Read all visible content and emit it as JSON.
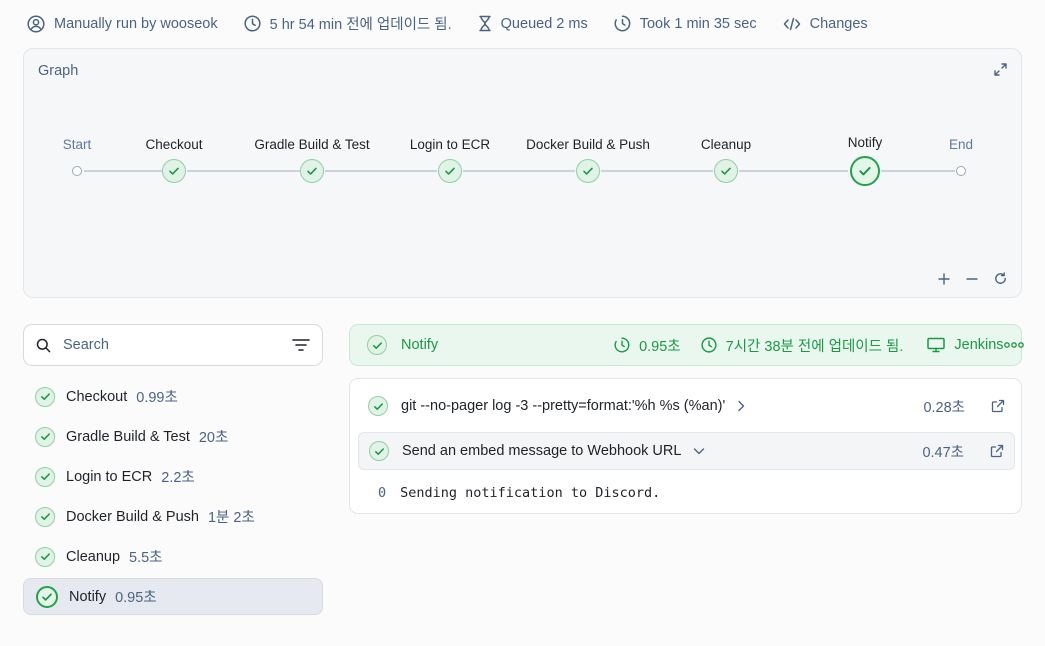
{
  "header": {
    "run_by": "Manually run by wooseok",
    "updated": "5 hr 54 min 전에 업데이드 됨.",
    "queued": "Queued 2 ms",
    "took": "Took 1 min 35 sec",
    "changes": "Changes"
  },
  "graph": {
    "title": "Graph",
    "start": "Start",
    "end": "End",
    "stages": [
      "Checkout",
      "Gradle Build & Test",
      "Login to ECR",
      "Docker Build & Push",
      "Cleanup",
      "Notify"
    ],
    "selected": "Notify"
  },
  "search": {
    "placeholder": "Search"
  },
  "stage_list": [
    {
      "name": "Checkout",
      "duration": "0.99초"
    },
    {
      "name": "Gradle Build & Test",
      "duration": "20초"
    },
    {
      "name": "Login to ECR",
      "duration": "2.2초"
    },
    {
      "name": "Docker Build & Push",
      "duration": "1분 2초"
    },
    {
      "name": "Cleanup",
      "duration": "5.5초"
    },
    {
      "name": "Notify",
      "duration": "0.95초"
    }
  ],
  "detail": {
    "title": "Notify",
    "duration": "0.95초",
    "updated": "7시간 38분 전에 업데이드 됨.",
    "agent": "Jenkins"
  },
  "steps": [
    {
      "text": "git --no-pager log -3 --pretty=format:'%h %s (%an)'",
      "duration": "0.28초"
    },
    {
      "text": "Send an embed message to Webhook URL",
      "duration": "0.47초"
    }
  ],
  "log": {
    "line_number": "0",
    "text": "Sending notification to Discord."
  },
  "colors": {
    "success": "#22a34a",
    "muted_blue": "#4a6385",
    "success_bg": "#e9f7ee"
  }
}
